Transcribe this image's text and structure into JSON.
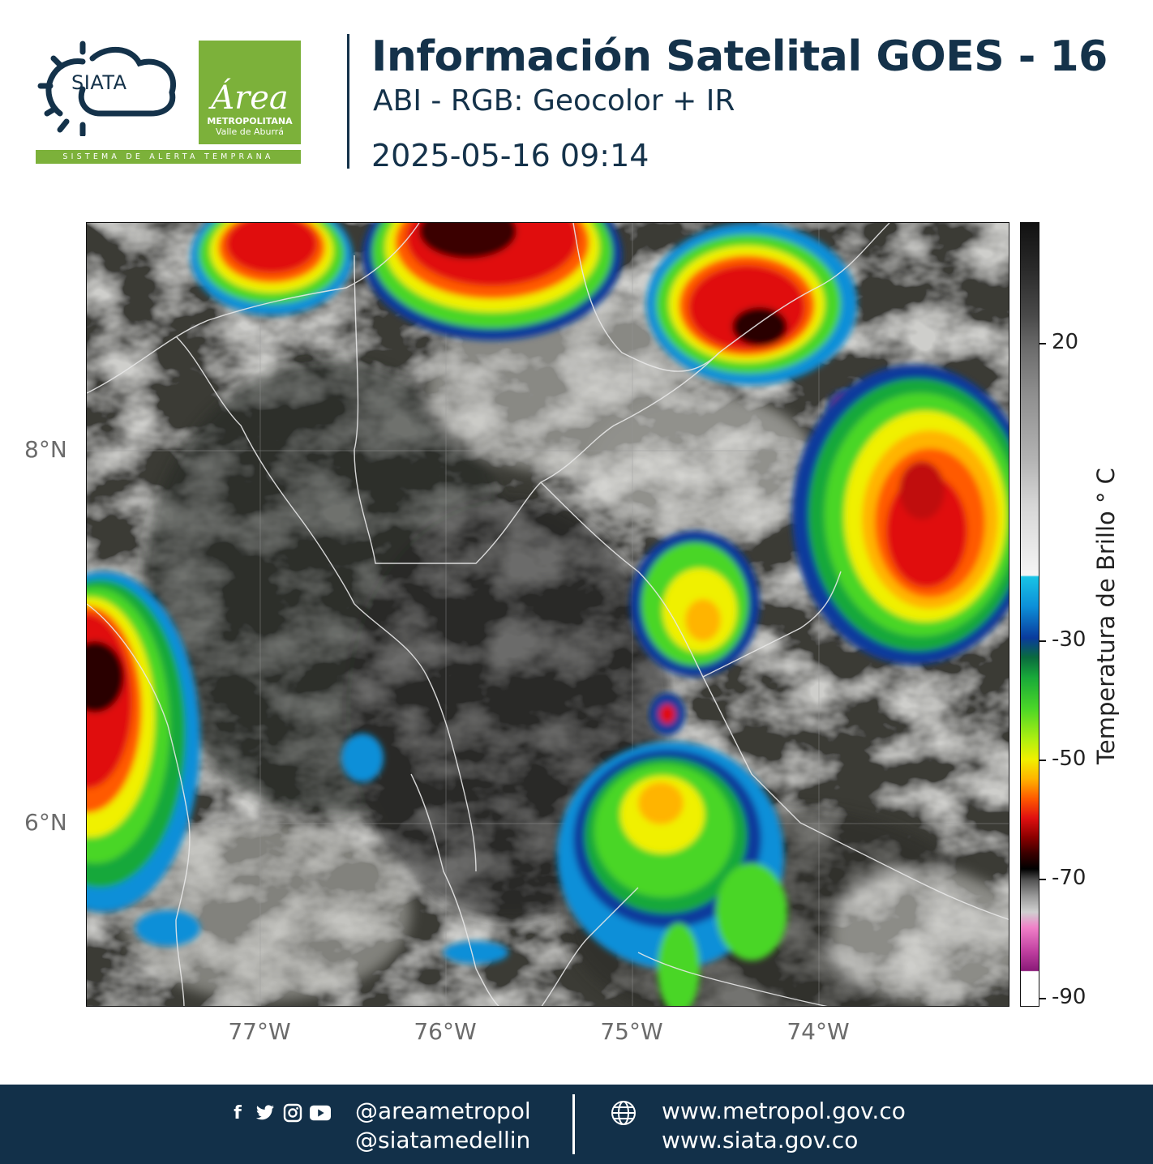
{
  "header": {
    "siata_logo_text": "SIATA",
    "siata_band_text": "SISTEMA DE ALERTA TEMPRANA",
    "area_logo_script": "Área",
    "area_logo_line1": "METROPOLITANA",
    "area_logo_line2": "Valle de Aburrá",
    "title": "Información Satelital GOES - 16",
    "subtitle": "ABI - RGB: Geocolor + IR",
    "timestamp": "2025-05-16 09:14"
  },
  "map": {
    "latitude_labels": [
      "8°N",
      "6°N"
    ],
    "longitude_labels": [
      "77°W",
      "76°W",
      "75°W",
      "74°W"
    ],
    "gridlines": true,
    "overlay": "country and department borders",
    "icons": [
      "siata-logo-icon",
      "area-metropolitana-logo-icon"
    ]
  },
  "colorbar": {
    "title": "Temperatura de Brillo ° C",
    "tick_labels": [
      "20",
      "-30",
      "-50",
      "-70",
      "-90"
    ],
    "colors": [
      "#111111",
      "#f5f5f5",
      "#18c4e6",
      "#0a3b9c",
      "#18a83a",
      "#f0f000",
      "#ff5a00",
      "#e01010",
      "#000000",
      "#f080c8",
      "#8a1a78",
      "#ffffff"
    ]
  },
  "footer": {
    "social_icons": [
      "facebook-icon",
      "twitter-icon",
      "instagram-icon",
      "youtube-icon"
    ],
    "handle_1": "@areametropol",
    "handle_2": "@siatamedellin",
    "website_1": "www.metropol.gov.co",
    "website_2": "www.siata.gov.co",
    "background_color": "#123049"
  }
}
